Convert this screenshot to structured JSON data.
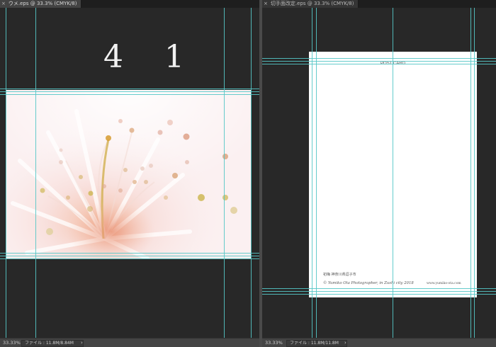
{
  "left_window": {
    "tab_close": "×",
    "tab_title": "ウメ.eps @ 33.3% (CMYK/8)",
    "big_number": "4 1",
    "status": {
      "zoom": "33.33%",
      "file_info": "ファイル : 11.8M/8.84M",
      "arrow": "›"
    },
    "photo_icon": "pink-flower-stamens-photo"
  },
  "right_window": {
    "tab_close": "×",
    "tab_title": "切手面改定.eps @ 33.3% (CMYK/8)",
    "postcard": {
      "title": "POST CARD",
      "address": "初梅 神奈川県逗子市",
      "credit": "© Yumiko Ota Photographer, in Zushi city 2018",
      "url": "www.yumiko-ota.com"
    },
    "status": {
      "zoom": "33.33%",
      "file_info": "ファイル : 11.8M/11.8M",
      "arrow": "›"
    }
  },
  "colors": {
    "canvas": "#282828",
    "guide": "#54c7c7",
    "photo_bg": "#fbf2f2",
    "stamen_tip": "#d8a070",
    "stamen_yellow": "#c8b040"
  }
}
